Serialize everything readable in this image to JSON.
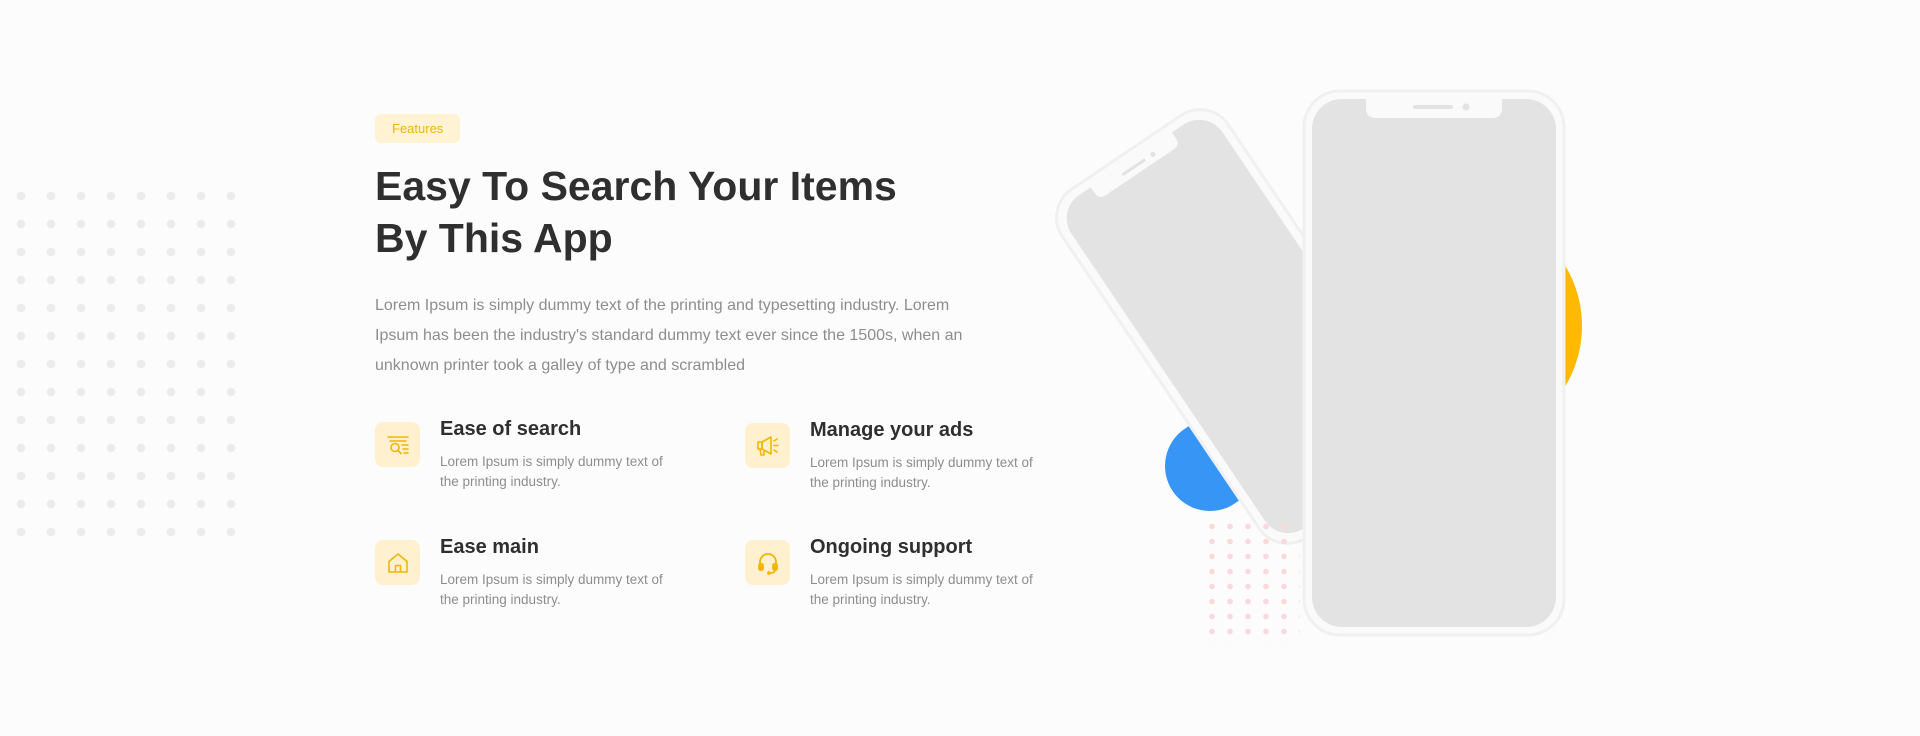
{
  "section": {
    "badge": "Features",
    "heading_line1": "Easy To Search Your Items",
    "heading_line2": "By This App",
    "intro": "Lorem Ipsum is simply dummy text of the printing and typesetting industry. Lorem Ipsum has been the industry's standard dummy text ever since the 1500s, when an unknown printer took a galley of type and scrambled"
  },
  "features": [
    {
      "title": "Ease of search",
      "text": "Lorem Ipsum is simply dummy text of the printing industry.",
      "icon": "search-list-icon"
    },
    {
      "title": "Manage your ads",
      "text": "Lorem Ipsum is simply dummy text of the printing industry.",
      "icon": "megaphone-icon"
    },
    {
      "title": "Ease main",
      "text": "Lorem Ipsum is simply dummy text of the printing industry.",
      "icon": "home-icon"
    },
    {
      "title": "Ongoing support",
      "text": "Lorem Ipsum is simply dummy text of the printing industry.",
      "icon": "headset-icon"
    }
  ],
  "colors": {
    "accent": "#ffb900",
    "badge_bg": "#fff3d3",
    "blue": "#3796f5",
    "heading": "#2f2f2f",
    "body_text": "#8d8d8d"
  }
}
